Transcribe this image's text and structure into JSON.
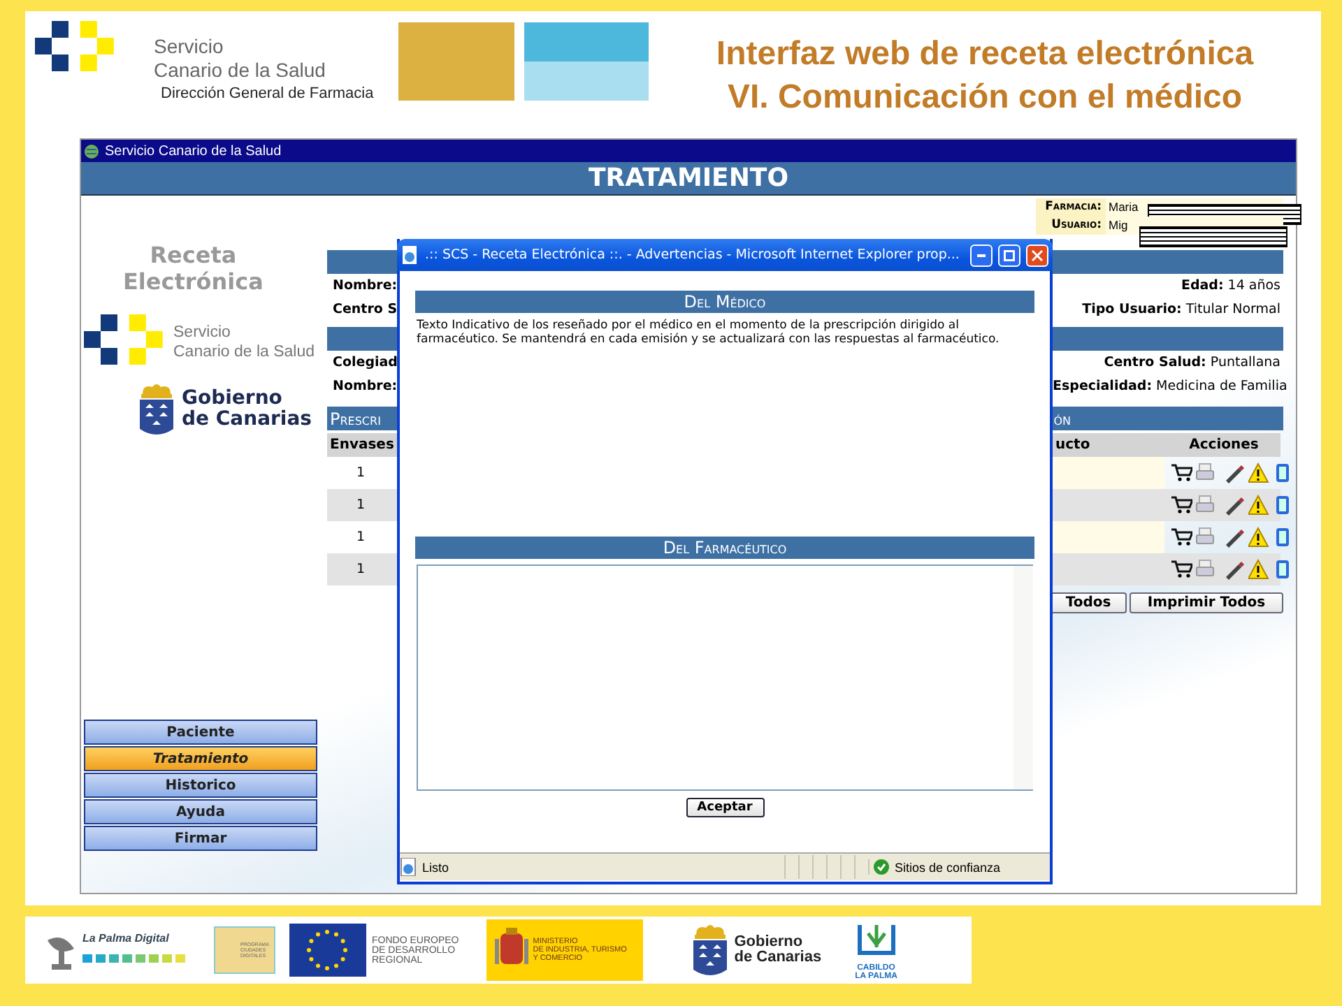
{
  "slide": {
    "org_lines": [
      "Servicio",
      "Canario de la Salud"
    ],
    "department": "Dirección General de Farmacia",
    "title_lines": [
      "Interfaz web de receta electrónica",
      "VI. Comunicación con el médico"
    ]
  },
  "browser": {
    "title": "Servicio Canario de la Salud"
  },
  "page": {
    "heading": "TRATAMIENTO",
    "app_name": [
      "Receta",
      "Electrónica"
    ],
    "scs_logo": [
      "Servicio",
      "Canario de la Salud"
    ],
    "gov_logo": [
      "Gobierno",
      "de Canarias"
    ],
    "session": [
      {
        "label": "Farmacia:",
        "value": "Maria",
        "redacted": true
      },
      {
        "label": "Usuario:",
        "value": "Mig",
        "redacted": true
      }
    ],
    "patient": {
      "left": [
        "Nombre:",
        "Centro S"
      ],
      "right": [
        {
          "label": "Edad:",
          "value": "14 años"
        },
        {
          "label": "Tipo Usuario:",
          "value": "Titular  Normal"
        }
      ]
    },
    "doctor": {
      "left": [
        "Colegiad",
        "Nombre:"
      ],
      "right": [
        {
          "label": "Centro Salud:",
          "value": "Puntallana"
        },
        {
          "label": "Especialidad:",
          "value": "Medicina de Familia"
        }
      ]
    },
    "prescription": {
      "title_start": "Prescri",
      "title_end": "ón",
      "columns": [
        "Envases",
        "ucto",
        "Acciones"
      ],
      "rows": [
        {
          "envases": "1"
        },
        {
          "envases": "1"
        },
        {
          "envases": "1"
        },
        {
          "envases": "1"
        }
      ]
    },
    "buttons": [
      "Todos",
      "Imprimir Todos"
    ],
    "nav": [
      {
        "label": "Paciente",
        "selected": false
      },
      {
        "label": "Tratamiento",
        "selected": true
      },
      {
        "label": "Historico",
        "selected": false
      },
      {
        "label": "Ayuda",
        "selected": false
      },
      {
        "label": "Firmar",
        "selected": false
      }
    ]
  },
  "popup": {
    "title": ".:: SCS - Receta Electrónica ::. - Advertencias - Microsoft Internet Explorer prop...",
    "doctor_heading": "Del Médico",
    "doctor_text": "Texto Indicativo de los reseñado por el médico en el momento de la prescripción dirigido al farmacéutico. Se mantendrá en cada emisión y se actualizará con las respuestas al farmacéutico.",
    "pharmacist_heading": "Del Farmacéutico",
    "accept": "Aceptar",
    "status": "Listo",
    "zone": "Sitios de confianza"
  },
  "footer": {
    "lapalma": "La Palma Digital",
    "programa": [
      "PROGRAMA",
      "CIUDADES",
      "DIGITALES"
    ],
    "feder": [
      "FONDO EUROPEO",
      "DE DESARROLLO",
      "REGIONAL"
    ],
    "ministerio": [
      "MINISTERIO",
      "DE INDUSTRIA, TURISMO",
      "Y COMERCIO"
    ],
    "gobierno": [
      "Gobierno",
      "de Canarias"
    ],
    "cabildo": [
      "CABILDO",
      "LA PALMA"
    ]
  }
}
